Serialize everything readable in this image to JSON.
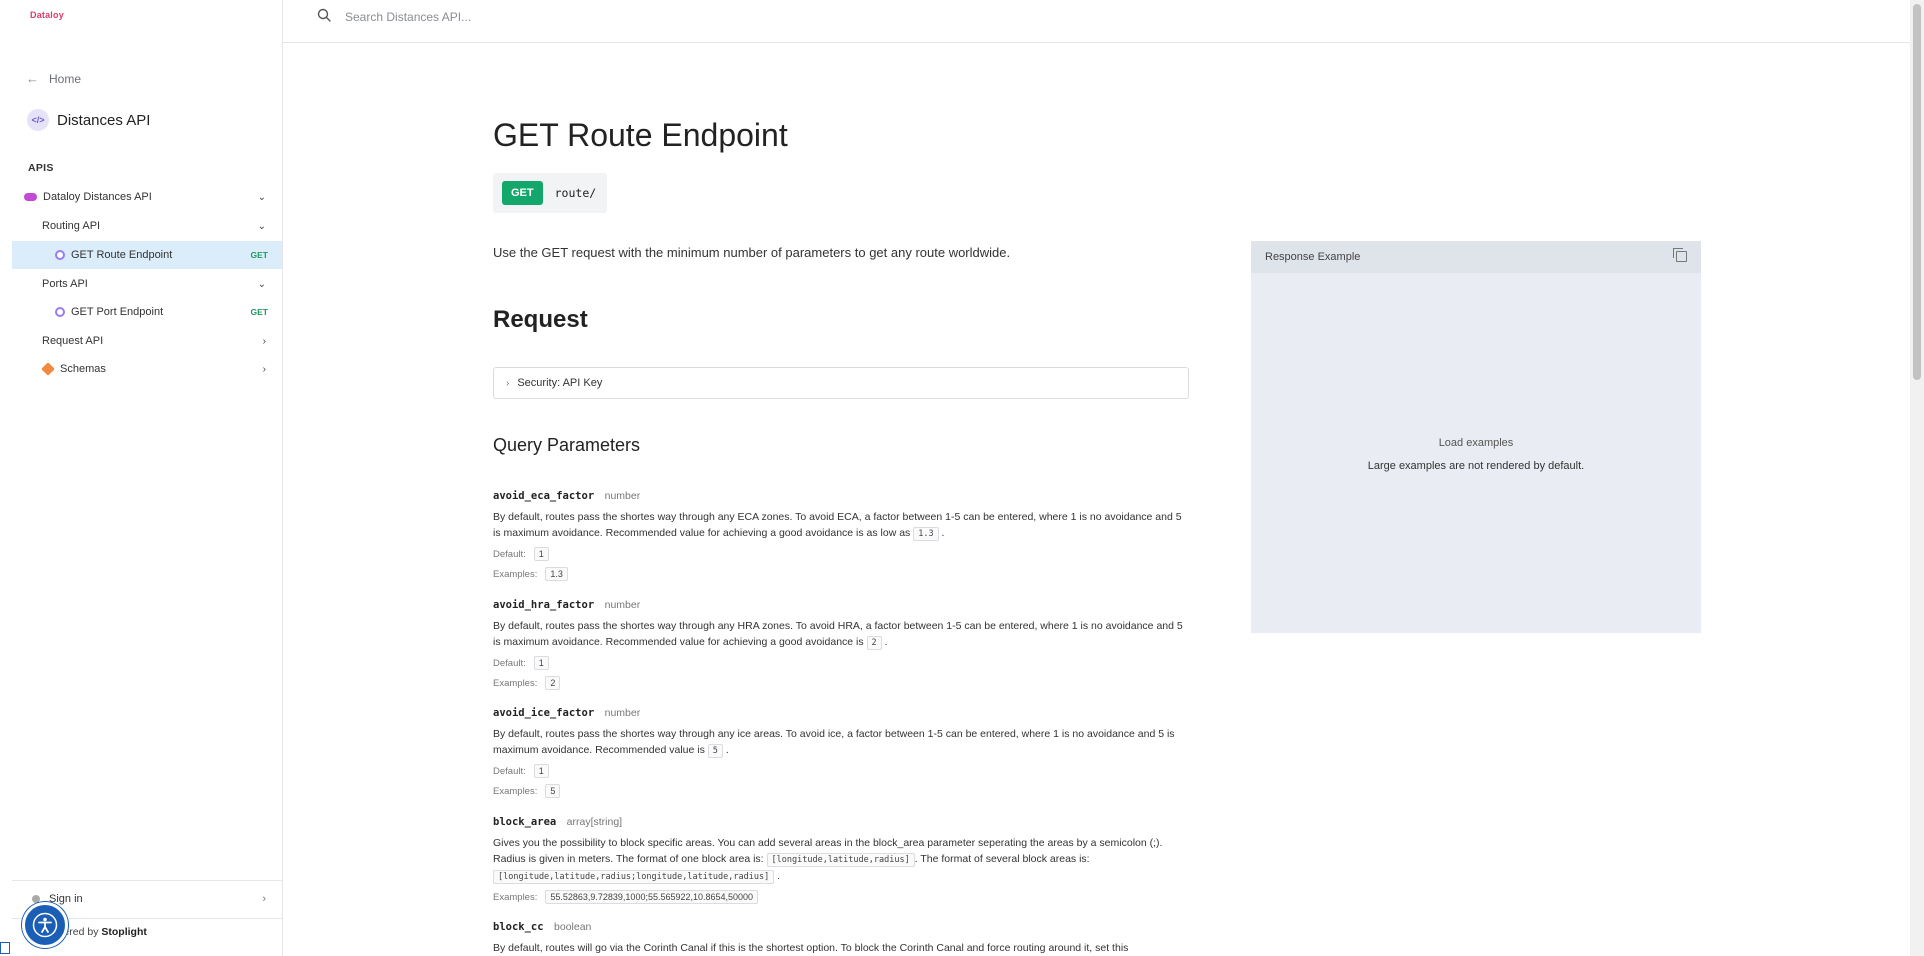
{
  "brand": {
    "name": "Dataloy"
  },
  "search": {
    "placeholder": "Search Distances API..."
  },
  "sidebar": {
    "home_label": "Home",
    "api_title": "Distances API",
    "api_icon": "</>",
    "section_label": "APIS",
    "items": [
      {
        "label": "Dataloy Distances API"
      },
      {
        "label": "Routing API"
      },
      {
        "label": "GET Route Endpoint",
        "method": "GET"
      },
      {
        "label": "Ports API"
      },
      {
        "label": "GET Port Endpoint",
        "method": "GET"
      },
      {
        "label": "Request API"
      },
      {
        "label": "Schemas"
      }
    ],
    "signin_label": "Sign in",
    "powered_prefix": "owered by",
    "powered_brand": "Stoplight"
  },
  "main": {
    "title": "GET Route Endpoint",
    "method": "GET",
    "path": "route/",
    "intro": "Use the GET request with the minimum number of parameters to get any route worldwide.",
    "request_heading": "Request",
    "security_label": "Security: API Key",
    "query_heading": "Query Parameters",
    "default_label": "Default:",
    "examples_label": "Examples:",
    "params": [
      {
        "name": "avoid_eca_factor",
        "type": "number",
        "desc_line1": "By default, routes pass the shortes way through any ECA zones. To avoid ECA, a factor between 1-5 can be entered, where 1 is no avoidance and 5",
        "desc_line2": "is maximum avoidance. Recommended value for achieving a good avoidance is as low as",
        "desc_code": "1.3",
        "desc_end": ".",
        "default": "1",
        "example": "1.3"
      },
      {
        "name": "avoid_hra_factor",
        "type": "number",
        "desc_line1": "By default, routes pass the shortes way through any HRA zones. To avoid HRA, a factor between 1-5 can be entered, where 1 is no avoidance and 5",
        "desc_line2": "is maximum avoidance. Recommended value for achieving a good avoidance is",
        "desc_code": "2",
        "desc_end": ".",
        "default": "1",
        "example": "2"
      },
      {
        "name": "avoid_ice_factor",
        "type": "number",
        "desc_line1": "By default, routes pass the shortes way through any ice areas. To avoid ice, a factor between 1-5 can be entered, where 1 is no avoidance and 5 is",
        "desc_line2": "maximum avoidance. Recommended value is",
        "desc_code": "5",
        "desc_end": ".",
        "default": "1",
        "example": "5"
      },
      {
        "name": "block_area",
        "type": "array[string]",
        "desc_line1": "Gives you the possibility to block specific areas. You can add several areas in the block_area parameter seperating the areas by a semicolon (;).",
        "desc_line2": "Radius is given in meters. The format of one block area is:",
        "desc_code": "[longitude,latitude,radius]",
        "desc_mid": ". The format of several block areas is:",
        "desc_code2": "[longitude,latitude,radius;longitude,latitude,radius]",
        "desc_end": ".",
        "example": "55.52863,9.72839,1000;55.565922,10.8654,50000"
      },
      {
        "name": "block_cc",
        "type": "boolean",
        "desc_line1": "By default, routes will go via the Corinth Canal if this is the shortest option. To block the Corinth Canal and force routing around it, set this"
      }
    ]
  },
  "response": {
    "title": "Response Example",
    "load_label": "Load examples",
    "note": "Large examples are not rendered by default."
  },
  "colors": {
    "accent_green": "#13a76b",
    "active_nav_bg": "#dbedfa",
    "panel_bg": "#e9ecf2",
    "brand_pink": "#d63d6b"
  }
}
